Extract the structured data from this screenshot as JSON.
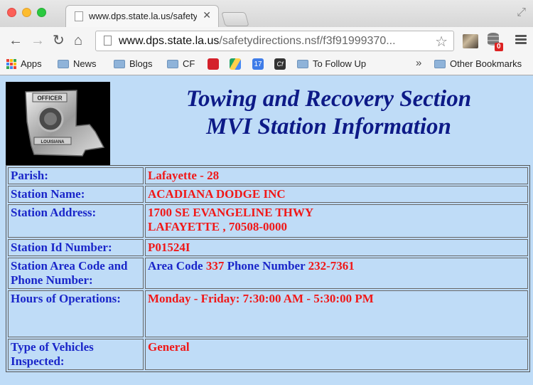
{
  "browser": {
    "tab_title": "www.dps.state.la.us/safety",
    "url_host": "www.dps.state.la.us",
    "url_path": "/safetydirections.nsf/f3f91999370...",
    "extension_badge": "0"
  },
  "bookmarks": {
    "apps": "Apps",
    "news": "News",
    "blogs": "Blogs",
    "cf": "CF",
    "to_follow_up": "To Follow Up",
    "other": "Other Bookmarks",
    "calendar_icon_text": "17",
    "cf_icon_text": "Cf"
  },
  "page": {
    "title_line1": "Towing and Recovery Section",
    "title_line2": "MVI Station Information",
    "badge_text_top": "OFFICER",
    "badge_text_bottom": "LOUISIANA",
    "rows": {
      "parish_label": "Parish:",
      "parish_value": "Lafayette - 28",
      "station_name_label": "Station Name:",
      "station_name_value": "ACADIANA DODGE INC",
      "address_label": "Station Address:",
      "address_line1": "1700 SE EVANGELINE THWY",
      "address_line2": "LAFAYETTE , 70508-0000",
      "station_id_label": "Station Id Number:",
      "station_id_value": "P01524I",
      "phone_label": "Station Area Code and Phone Number:",
      "area_code_prefix": "Area Code",
      "area_code_value": "337",
      "phone_prefix": "Phone Number",
      "phone_value": "232-7361",
      "hours_label": "Hours of Operations:",
      "hours_value": "Monday - Friday: 7:30:00 AM - 5:30:00 PM",
      "vehicles_label": "Type of Vehicles Inspected:",
      "vehicles_value": "General"
    }
  },
  "colors": {
    "page_bg": "#bfdcf7",
    "heading": "#0d1a87",
    "label": "#1a26c9",
    "value": "#f01818"
  }
}
